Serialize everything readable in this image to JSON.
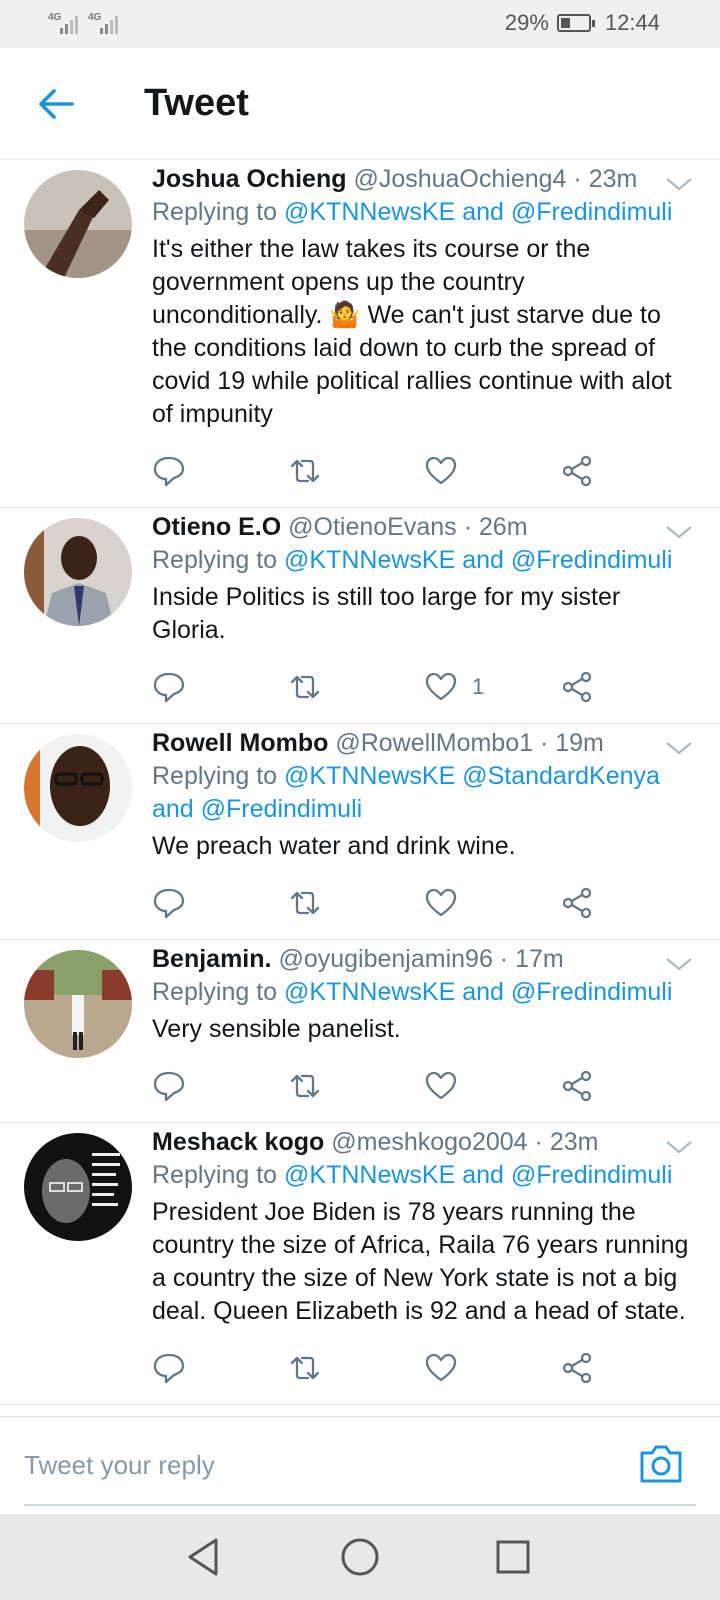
{
  "status_bar": {
    "signal_1_label": "4G",
    "signal_2_label": "4G",
    "battery": "29%",
    "time": "12:44"
  },
  "header": {
    "title": "Tweet",
    "back_icon": "arrow-left-icon"
  },
  "accent_color": "#1b95e0",
  "tweets": [
    {
      "name": "Joshua Ochieng",
      "handle": "@JoshuaOchieng4",
      "time": "23m",
      "replying_prefix": "Replying to",
      "mentions": "@KTNNewsKE and @Fredindimuli",
      "text": "It's either the law takes its course or the government opens up the country unconditionally. 🤷 We can't just starve  due to the conditions laid down to curb the spread of covid 19 while political rallies continue with alot of impunity",
      "like_count": ""
    },
    {
      "name": "Otieno E.O",
      "handle": "@OtienoEvans",
      "time": "26m",
      "replying_prefix": "Replying to",
      "mentions": "@KTNNewsKE and @Fredindimuli",
      "text": "Inside Politics is still too large for my sister Gloria.",
      "like_count": "1"
    },
    {
      "name": "Rowell Mombo",
      "handle": "@RowellMombo1",
      "time": "19m",
      "replying_prefix": "Replying to",
      "mentions": "@KTNNewsKE @StandardKenya and @Fredindimuli",
      "text": "We preach water and drink wine.",
      "like_count": ""
    },
    {
      "name": "Benjamin.",
      "handle": "@oyugibenjamin96",
      "time": "17m",
      "replying_prefix": "Replying to",
      "mentions": "@KTNNewsKE and @Fredindimuli",
      "text": "Very sensible panelist.",
      "like_count": ""
    },
    {
      "name": "Meshack kogo",
      "handle": "@meshkogo2004",
      "time": "23m",
      "replying_prefix": "Replying to",
      "mentions": "@KTNNewsKE and @Fredindimuli",
      "text": "President Joe Biden is 78 years running the country the size of Africa, Raila 76 years running a country the size of New York state is not a big deal. Queen Elizabeth is 92 and a head of state.",
      "like_count": ""
    }
  ],
  "reply_bar": {
    "placeholder": "Tweet your reply",
    "camera_icon": "camera-icon"
  },
  "nav_bar": {
    "back": "triangle-back-icon",
    "home": "circle-home-icon",
    "recents": "square-recents-icon"
  }
}
